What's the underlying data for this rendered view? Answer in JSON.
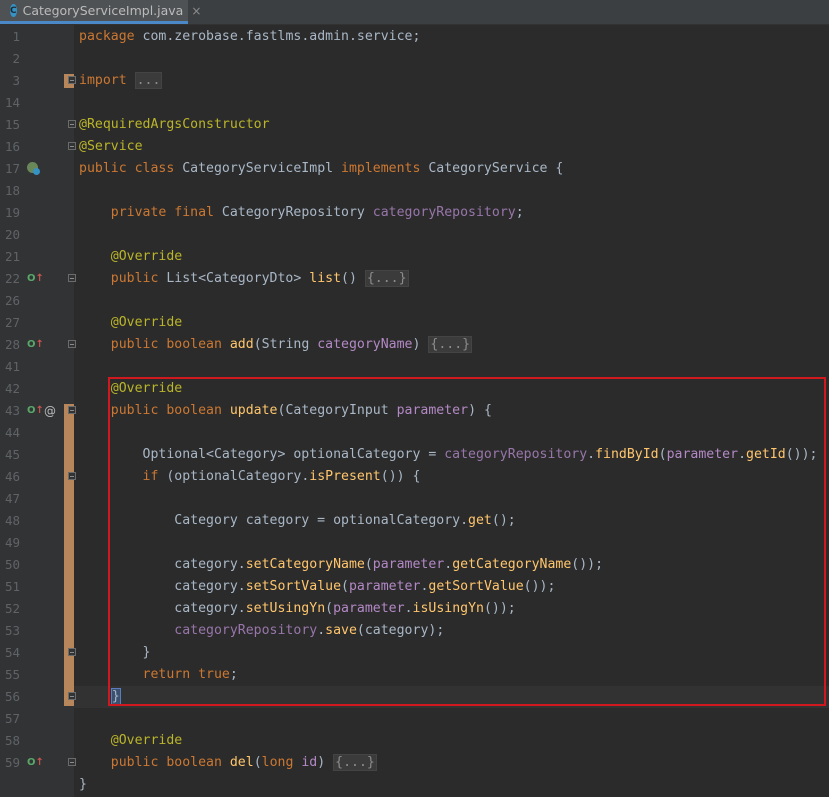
{
  "tab": {
    "icon_letter": "C",
    "filename": "CategoryServiceImpl.java",
    "close": "×"
  },
  "lines": [
    {
      "n": "1",
      "code": [
        [
          "kw",
          "package "
        ],
        [
          "ty",
          "com.zerobase.fastlms.admin.service;"
        ]
      ]
    },
    {
      "n": "2",
      "code": []
    },
    {
      "n": "3",
      "code": [
        [
          "kw",
          "import "
        ],
        [
          "fold-txt",
          "..."
        ]
      ]
    },
    {
      "n": "14",
      "code": []
    },
    {
      "n": "15",
      "code": [
        [
          "an",
          "@RequiredArgsConstructor"
        ]
      ]
    },
    {
      "n": "16",
      "code": [
        [
          "an",
          "@Service"
        ]
      ]
    },
    {
      "n": "17",
      "code": [
        [
          "kw",
          "public class "
        ],
        [
          "ty",
          "CategoryServiceImpl "
        ],
        [
          "kw",
          "implements "
        ],
        [
          "ty",
          "CategoryService {"
        ]
      ]
    },
    {
      "n": "18",
      "code": []
    },
    {
      "n": "19",
      "code": [
        [
          "ty",
          "    "
        ],
        [
          "kw",
          "private final "
        ],
        [
          "ty",
          "CategoryRepository "
        ],
        [
          "fd",
          "categoryRepository"
        ],
        [
          "ty",
          ";"
        ]
      ]
    },
    {
      "n": "20",
      "code": []
    },
    {
      "n": "21",
      "code": [
        [
          "ty",
          "    "
        ],
        [
          "an",
          "@Override"
        ]
      ]
    },
    {
      "n": "22",
      "code": [
        [
          "ty",
          "    "
        ],
        [
          "kw",
          "public "
        ],
        [
          "ty",
          "List<CategoryDto> "
        ],
        [
          "fn",
          "list"
        ],
        [
          "ty",
          "() "
        ],
        [
          "fold-txt",
          "{...}"
        ]
      ]
    },
    {
      "n": "26",
      "code": []
    },
    {
      "n": "27",
      "code": [
        [
          "ty",
          "    "
        ],
        [
          "an",
          "@Override"
        ]
      ]
    },
    {
      "n": "28",
      "code": [
        [
          "ty",
          "    "
        ],
        [
          "kw",
          "public boolean "
        ],
        [
          "fn",
          "add"
        ],
        [
          "ty",
          "(String "
        ],
        [
          "par",
          "categoryName"
        ],
        [
          "ty",
          ") "
        ],
        [
          "fold-txt",
          "{...}"
        ]
      ]
    },
    {
      "n": "41",
      "code": []
    },
    {
      "n": "42",
      "code": [
        [
          "ty",
          "    "
        ],
        [
          "an",
          "@Override"
        ]
      ]
    },
    {
      "n": "43",
      "code": [
        [
          "ty",
          "    "
        ],
        [
          "kw",
          "public boolean "
        ],
        [
          "fn",
          "update"
        ],
        [
          "ty",
          "(CategoryInput "
        ],
        [
          "par",
          "parameter"
        ],
        [
          "ty",
          ") {"
        ]
      ]
    },
    {
      "n": "44",
      "code": []
    },
    {
      "n": "45",
      "code": [
        [
          "ty",
          "        Optional<Category> optionalCategory = "
        ],
        [
          "fd",
          "categoryRepository"
        ],
        [
          "ty",
          "."
        ],
        [
          "fn",
          "findById"
        ],
        [
          "ty",
          "("
        ],
        [
          "par",
          "parameter"
        ],
        [
          "ty",
          "."
        ],
        [
          "fn",
          "getId"
        ],
        [
          "ty",
          "());"
        ]
      ]
    },
    {
      "n": "46",
      "code": [
        [
          "ty",
          "        "
        ],
        [
          "kw",
          "if "
        ],
        [
          "ty",
          "(optionalCategory."
        ],
        [
          "fn",
          "isPresent"
        ],
        [
          "ty",
          "()) {"
        ]
      ]
    },
    {
      "n": "47",
      "code": []
    },
    {
      "n": "48",
      "code": [
        [
          "ty",
          "            Category category = optionalCategory."
        ],
        [
          "fn",
          "get"
        ],
        [
          "ty",
          "();"
        ]
      ]
    },
    {
      "n": "49",
      "code": []
    },
    {
      "n": "50",
      "code": [
        [
          "ty",
          "            category."
        ],
        [
          "fn",
          "setCategoryName"
        ],
        [
          "ty",
          "("
        ],
        [
          "par",
          "parameter"
        ],
        [
          "ty",
          "."
        ],
        [
          "fn",
          "getCategoryName"
        ],
        [
          "ty",
          "());"
        ]
      ]
    },
    {
      "n": "51",
      "code": [
        [
          "ty",
          "            category."
        ],
        [
          "fn",
          "setSortValue"
        ],
        [
          "ty",
          "("
        ],
        [
          "par",
          "parameter"
        ],
        [
          "ty",
          "."
        ],
        [
          "fn",
          "getSortValue"
        ],
        [
          "ty",
          "());"
        ]
      ]
    },
    {
      "n": "52",
      "code": [
        [
          "ty",
          "            category."
        ],
        [
          "fn",
          "setUsingYn"
        ],
        [
          "ty",
          "("
        ],
        [
          "par",
          "parameter"
        ],
        [
          "ty",
          "."
        ],
        [
          "fn",
          "isUsingYn"
        ],
        [
          "ty",
          "());"
        ]
      ]
    },
    {
      "n": "53",
      "code": [
        [
          "ty",
          "            "
        ],
        [
          "fd",
          "categoryRepository"
        ],
        [
          "ty",
          "."
        ],
        [
          "fn",
          "save"
        ],
        [
          "ty",
          "(category);"
        ]
      ]
    },
    {
      "n": "54",
      "code": [
        [
          "ty",
          "        }"
        ]
      ]
    },
    {
      "n": "55",
      "code": [
        [
          "ty",
          "        "
        ],
        [
          "kw",
          "return true"
        ],
        [
          "ty",
          ";"
        ]
      ]
    },
    {
      "n": "56",
      "code": [
        [
          "ty",
          "    "
        ],
        [
          "caret-brace",
          "}"
        ]
      ]
    },
    {
      "n": "57",
      "code": []
    },
    {
      "n": "58",
      "code": [
        [
          "ty",
          "    "
        ],
        [
          "an",
          "@Override"
        ]
      ]
    },
    {
      "n": "59",
      "code": [
        [
          "ty",
          "    "
        ],
        [
          "kw",
          "public boolean "
        ],
        [
          "fn",
          "del"
        ],
        [
          "ty",
          "("
        ],
        [
          "kw",
          "long "
        ],
        [
          "par",
          "id"
        ],
        [
          "ty",
          ") "
        ],
        [
          "fold-txt",
          "{...}"
        ]
      ]
    },
    {
      "n": "",
      "code": [
        [
          "ty",
          "}"
        ]
      ]
    }
  ],
  "gutter_marks": {
    "17": "spring",
    "22": "override",
    "28": "override",
    "43": "override-at",
    "59": "override"
  },
  "folds": [
    "3",
    "15",
    "16",
    "22",
    "28",
    "43",
    "46",
    "54",
    "56",
    "59"
  ],
  "colors": {
    "background": "#2b2b2b",
    "keyword": "#cc7832",
    "annotation": "#bbb529",
    "method": "#ffc66d",
    "field": "#9876aa",
    "highlight_box": "#d0191e"
  }
}
